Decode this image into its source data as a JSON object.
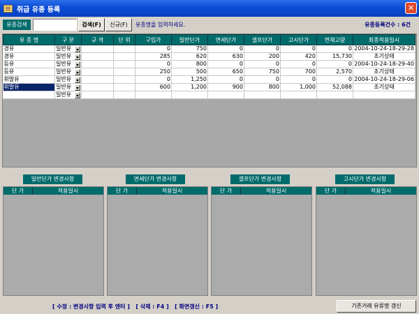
{
  "window": {
    "title": "취급 유종 등록"
  },
  "toolbar": {
    "search_label": "유종검색",
    "search_value": "",
    "search_button": "검색(F)",
    "new_button": "신규(F)",
    "hint": "유종명을 입력하세요.",
    "count": "유종등록건수 : 6건"
  },
  "grid": {
    "headers": [
      "유 종 명",
      "구 분",
      "규 격",
      "단 위",
      "구입가",
      "일반단가",
      "면세단가",
      "셀프단가",
      "고시단가",
      "현재고량",
      "최종적용일시"
    ],
    "rows": [
      {
        "name": "경유",
        "type": "일반유",
        "spec": "",
        "unit": "",
        "purchase": "0",
        "general": "750",
        "taxfree": "0",
        "self": "0",
        "notice": "0",
        "stock": "0",
        "date": "2004-10-24-18-29-28",
        "selected": false
      },
      {
        "name": "경유",
        "type": "일반유",
        "spec": "",
        "unit": "",
        "purchase": "285",
        "general": "620",
        "taxfree": "630",
        "self": "200",
        "notice": "420",
        "stock": "15,730",
        "date": "초기상태",
        "selected": false
      },
      {
        "name": "등유",
        "type": "일반유",
        "spec": "",
        "unit": "",
        "purchase": "0",
        "general": "800",
        "taxfree": "0",
        "self": "0",
        "notice": "0",
        "stock": "0",
        "date": "2004-10-24-18-29-40",
        "selected": false
      },
      {
        "name": "등유",
        "type": "일반유",
        "spec": "",
        "unit": "",
        "purchase": "250",
        "general": "500",
        "taxfree": "650",
        "self": "750",
        "notice": "700",
        "stock": "2,570",
        "date": "초기상태",
        "selected": false
      },
      {
        "name": "휘발유",
        "type": "일반유",
        "spec": "",
        "unit": "",
        "purchase": "0",
        "general": "1,250",
        "taxfree": "0",
        "self": "0",
        "notice": "0",
        "stock": "0",
        "date": "2004-10-24-18-29-06",
        "selected": false
      },
      {
        "name": "휘발유",
        "type": "일반유",
        "spec": "",
        "unit": "",
        "purchase": "600",
        "general": "1,200",
        "taxfree": "900",
        "self": "800",
        "notice": "1,000",
        "stock": "52,088",
        "date": "초기상태",
        "selected": true
      },
      {
        "name": "",
        "type": "일반유",
        "spec": "",
        "unit": "",
        "purchase": "",
        "general": "",
        "taxfree": "",
        "self": "",
        "notice": "",
        "stock": "",
        "date": "",
        "selected": false
      }
    ]
  },
  "panels": [
    {
      "title": "일반단가 변경사항",
      "col_price": "단 가",
      "col_date": "적용일시"
    },
    {
      "title": "면세단가 변경사항",
      "col_price": "단 가",
      "col_date": "적용일시"
    },
    {
      "title": "셀프단가 변경사항",
      "col_price": "단 가",
      "col_date": "적용일시"
    },
    {
      "title": "고시단가 변경사항",
      "col_price": "단 가",
      "col_date": "적용일시"
    }
  ],
  "status": {
    "text": "[ 수정 : 변경사항 입력 후 엔터 ]   [ 삭제 : F4 ]   [ 화면갱신 : F5 ]",
    "update_button": "기존거래 유류명 갱신"
  },
  "colors": {
    "header_teal": "#006b6b",
    "title_blue": "#0a4bd6",
    "selection": "#0a246a",
    "hint_navy": "#000080"
  },
  "icons": {
    "app": "app-window-icon",
    "close": "close-icon",
    "dropdown": "chevron-down-icon"
  }
}
